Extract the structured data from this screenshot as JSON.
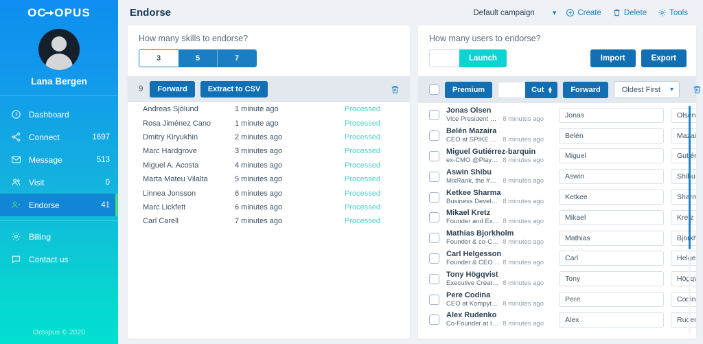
{
  "brand": {
    "logo_text_before": "OC",
    "logo_text_after": "OPUS",
    "footer": "Octopus © 2020",
    "accent_green": "#3ddc84",
    "accent_cyan": "#0fd2d2",
    "primary_blue": "#126fb3",
    "status_green": "#4ecfc8"
  },
  "profile": {
    "name": "Lana Bergen",
    "avatar_icon": "user-avatar-icon"
  },
  "sidebar": {
    "groups": [
      {
        "items": [
          {
            "label": "Dashboard",
            "count": "",
            "icon": "dashboard-icon",
            "active": false
          },
          {
            "label": "Connect",
            "count": "1697",
            "icon": "share-icon",
            "active": false
          },
          {
            "label": "Message",
            "count": "513",
            "icon": "envelope-icon",
            "active": false
          },
          {
            "label": "Visit",
            "count": "0",
            "icon": "users-icon",
            "active": false
          },
          {
            "label": "Endorse",
            "count": "41",
            "icon": "user-check-icon",
            "active": true
          }
        ]
      },
      {
        "items": [
          {
            "label": "Billing",
            "count": "",
            "icon": "gear-icon",
            "active": false
          },
          {
            "label": "Contact us",
            "count": "",
            "icon": "comment-icon",
            "active": false
          }
        ]
      }
    ]
  },
  "topbar": {
    "title": "Endorse",
    "campaign_label": "Default campaign",
    "campaign_chevron": "chevron-down-icon",
    "actions": [
      {
        "label": "Create",
        "icon": "plus-circle-icon"
      },
      {
        "label": "Delete",
        "icon": "trash-icon"
      },
      {
        "label": "Tools",
        "icon": "gear-icon"
      }
    ]
  },
  "left_panel": {
    "question": "How many skills to endorse?",
    "segments": [
      {
        "value": "3",
        "selected": true
      },
      {
        "value": "5",
        "selected": false
      },
      {
        "value": "7",
        "selected": false
      }
    ],
    "toolbar": {
      "count": "9",
      "forward_label": "Forward",
      "extract_label": "Extract to CSV",
      "trash_icon": "trash-icon"
    },
    "rows": [
      {
        "name": "Andreas Sjölund",
        "time": "1 minute ago",
        "status": "Processed"
      },
      {
        "name": "Rosa Jiménez Cano",
        "time": "1 minute ago",
        "status": "Processed"
      },
      {
        "name": "Dmitry Kiryukhin",
        "time": "2 minutes ago",
        "status": "Processed"
      },
      {
        "name": "Marc Hardgrove",
        "time": "3 minutes ago",
        "status": "Processed"
      },
      {
        "name": "Miguel A. Acosta",
        "time": "4 minutes ago",
        "status": "Processed"
      },
      {
        "name": "Marta Mateu Vilalta",
        "time": "5 minutes ago",
        "status": "Processed"
      },
      {
        "name": "Linnea Jonsson",
        "time": "6 minutes ago",
        "status": "Processed"
      },
      {
        "name": "Marc Lickfett",
        "time": "6 minutes ago",
        "status": "Processed"
      },
      {
        "name": "Carl Carell",
        "time": "7 minutes ago",
        "status": "Processed"
      }
    ]
  },
  "right_panel": {
    "question": "How many users to endorse?",
    "amount_value": "",
    "amount_placeholder": "",
    "launch_label": "Launch",
    "import_label": "Import",
    "export_label": "Export",
    "toolbar": {
      "select_all_checkbox": "unchecked",
      "premium_label": "Premium",
      "cut_value": "",
      "cut_label": "Cut",
      "cut_spinner_icon": "spinner-up-down-icon",
      "forward_label": "Forward",
      "sort_label": "Oldest First",
      "sort_chevron": "chevron-down-icon",
      "trash_icon": "trash-icon"
    },
    "rows": [
      {
        "name": "Jonas Olsen",
        "title": "Vice President Vi...",
        "time": "8 minutes ago",
        "first": "Jonas",
        "last": "Olsen"
      },
      {
        "name": "Belén Mazaira",
        "title": "CEO at SPIKE TEC...",
        "time": "8 minutes ago",
        "first": "Belén",
        "last": "Mazaira"
      },
      {
        "name": "Miguel Gutiérrez-barquin",
        "title": "ex-CMO @PlayGi...",
        "time": "8 minutes ago",
        "first": "Miguel",
        "last": "Gutiérrez-barquin"
      },
      {
        "name": "Aswin Shibu",
        "title": "MixRank, the #1 ...",
        "time": "8 minutes ago",
        "first": "Aswin",
        "last": "Shibu"
      },
      {
        "name": "Ketkee Sharma",
        "title": "Business Develop...",
        "time": "8 minutes ago",
        "first": "Ketkee",
        "last": "Sharma"
      },
      {
        "name": "Mikael Kretz",
        "title": "Founder and Exec...",
        "time": "8 minutes ago",
        "first": "Mikael",
        "last": "Kretz"
      },
      {
        "name": "Mathias Bjorkholm",
        "title": "Founder & co-CE...",
        "time": "8 minutes ago",
        "first": "Mathias",
        "last": "Bjorkholm"
      },
      {
        "name": "Carl Helgesson",
        "title": "Founder & CEO a...",
        "time": "8 minutes ago",
        "first": "Carl",
        "last": "Helgesson"
      },
      {
        "name": "Tony Högqvist",
        "title": "Executive Creativ...",
        "time": "8 minutes ago",
        "first": "Tony",
        "last": "Högqvist"
      },
      {
        "name": "Pere Codina",
        "title": "CEO at Kompyte |...",
        "time": "8 minutes ago",
        "first": "Pere",
        "last": "Codina"
      },
      {
        "name": "Alex Rudenko",
        "title": "Co-Founder at IT ...",
        "time": "8 minutes ago",
        "first": "Alex",
        "last": "Rudenko"
      }
    ]
  }
}
